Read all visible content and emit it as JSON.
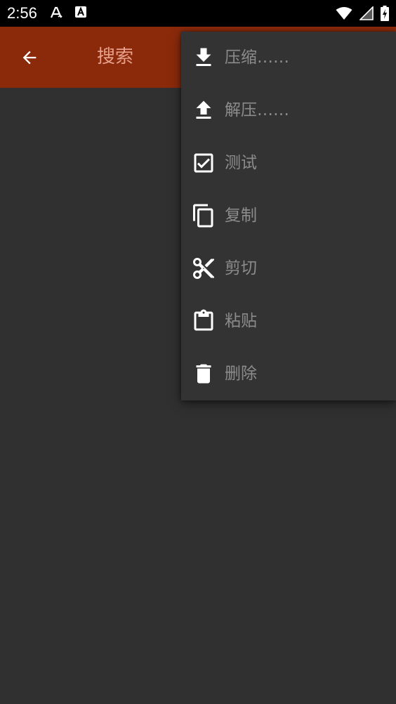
{
  "status_bar": {
    "time": "2:56",
    "left_icons": [
      "font-icon",
      "a-box-icon"
    ],
    "right_icons": [
      "wifi-icon",
      "signal-icon",
      "battery-charging-icon"
    ]
  },
  "app_bar": {
    "back_icon": "arrow-back-icon",
    "title": "搜索",
    "background_color": "#8b2a0b",
    "title_color": "#e8a08c"
  },
  "menu": {
    "items": [
      {
        "label": "压缩……",
        "icon": "download-icon"
      },
      {
        "label": "解压……",
        "icon": "upload-icon"
      },
      {
        "label": "测试",
        "icon": "checkbox-icon"
      },
      {
        "label": "复制",
        "icon": "copy-icon"
      },
      {
        "label": "剪切",
        "icon": "scissors-icon"
      },
      {
        "label": "粘贴",
        "icon": "clipboard-icon"
      },
      {
        "label": "删除",
        "icon": "delete-icon"
      }
    ]
  }
}
